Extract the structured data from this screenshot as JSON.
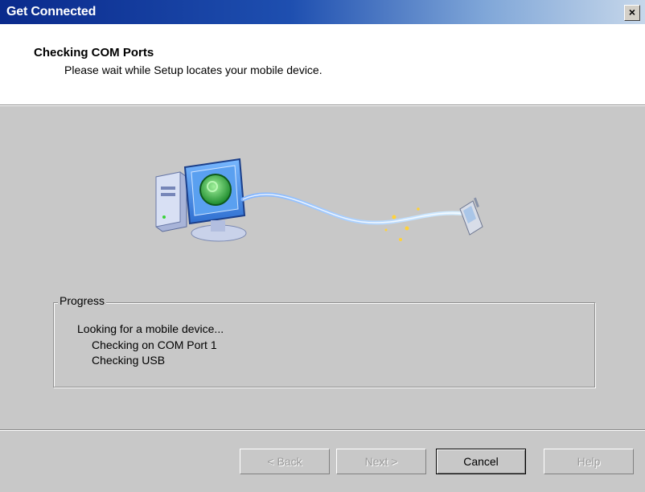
{
  "window": {
    "title": "Get Connected",
    "close_label": "×"
  },
  "header": {
    "title": "Checking COM Ports",
    "subtitle": "Please wait while Setup locates your mobile device."
  },
  "progress": {
    "label": "Progress",
    "lines": [
      "Looking for a mobile device...",
      "Checking on COM Port 1",
      "Checking USB"
    ]
  },
  "buttons": {
    "back": "< Back",
    "next": "Next >",
    "cancel": "Cancel",
    "help": "Help"
  },
  "colors": {
    "title_bar": "#0a2a8c",
    "dialog_face": "#c8c8c8",
    "header_bg": "#ffffff"
  }
}
